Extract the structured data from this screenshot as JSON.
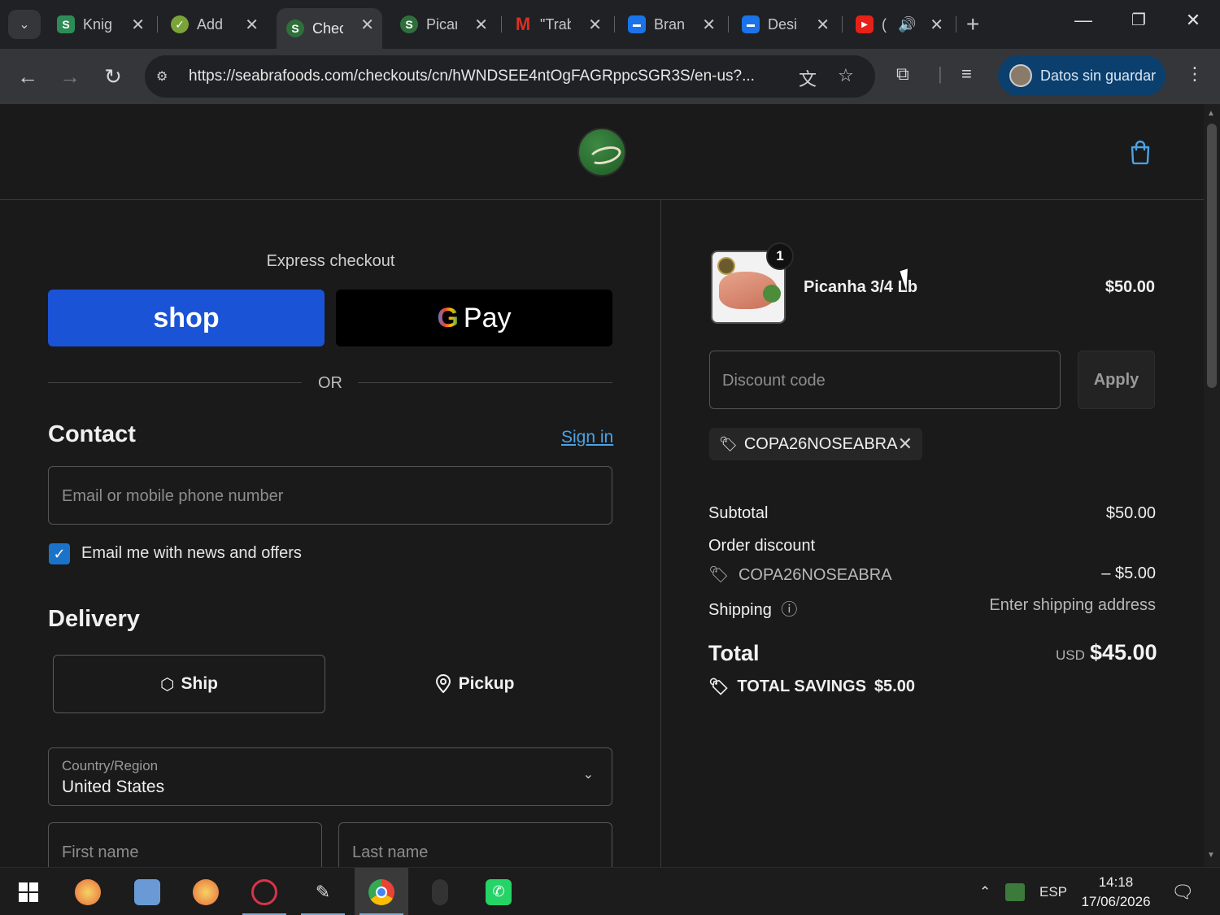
{
  "browser": {
    "tabs": [
      {
        "label": "Knig",
        "favicon": "S",
        "favicon_color": "#2e8b57"
      },
      {
        "label": "Add",
        "favicon": "✓",
        "favicon_color": "#7aa33a"
      },
      {
        "label": "Chec",
        "favicon": "S",
        "favicon_color": "#2f6f3b",
        "active": true
      },
      {
        "label": "Picar",
        "favicon": "S",
        "favicon_color": "#2f6f3b"
      },
      {
        "label": "\"Trab",
        "favicon": "M",
        "favicon_color": "#d93025"
      },
      {
        "label": "Bran",
        "favicon": "▬",
        "favicon_color": "#1a73e8"
      },
      {
        "label": "Desi",
        "favicon": "▬",
        "favicon_color": "#1a73e8"
      },
      {
        "label": "(",
        "favicon": "▶",
        "favicon_color": "#e62117"
      }
    ],
    "url": "https://seabrafoods.com/checkouts/cn/hWNDSEE4ntOgFAGRppcSGR3S/en-us?...",
    "profile_label": "Datos sin guardar"
  },
  "checkout": {
    "express_title": "Express checkout",
    "shop_pay_label": "shop",
    "gpay_g": "G",
    "gpay_label": "Pay",
    "or_label": "OR",
    "contact_heading": "Contact",
    "sign_in_label": "Sign in",
    "email_placeholder": "Email or mobile phone number",
    "newsletter_label": "Email me with news and offers",
    "newsletter_checked": true,
    "delivery_heading": "Delivery",
    "ship_label": "Ship",
    "pickup_label": "Pickup",
    "country_label": "Country/Region",
    "country_value": "United States",
    "first_name_placeholder": "First name",
    "last_name_placeholder": "Last name"
  },
  "summary": {
    "product_name": "Picanha 3/4 Lb",
    "product_qty": "1",
    "product_price": "$50.00",
    "discount_placeholder": "Discount code",
    "apply_label": "Apply",
    "applied_code": "COPA26NOSEABRA",
    "subtotal_label": "Subtotal",
    "subtotal_value": "$50.00",
    "order_discount_label": "Order discount",
    "order_discount_code": "COPA26NOSEABRA",
    "order_discount_value": "– $5.00",
    "shipping_label": "Shipping",
    "shipping_value": "Enter shipping address",
    "total_label": "Total",
    "total_currency": "USD",
    "total_value": "$45.00",
    "savings_label": "TOTAL SAVINGS",
    "savings_value": "$5.00"
  },
  "taskbar": {
    "language": "ESP",
    "time": "14:18",
    "date": "17/06/2026"
  },
  "colors": {
    "shop_pay": "#1a53d6",
    "link": "#4aa3e8",
    "checkbox": "#1a73c8",
    "profile_chip": "#0b3f6d"
  }
}
